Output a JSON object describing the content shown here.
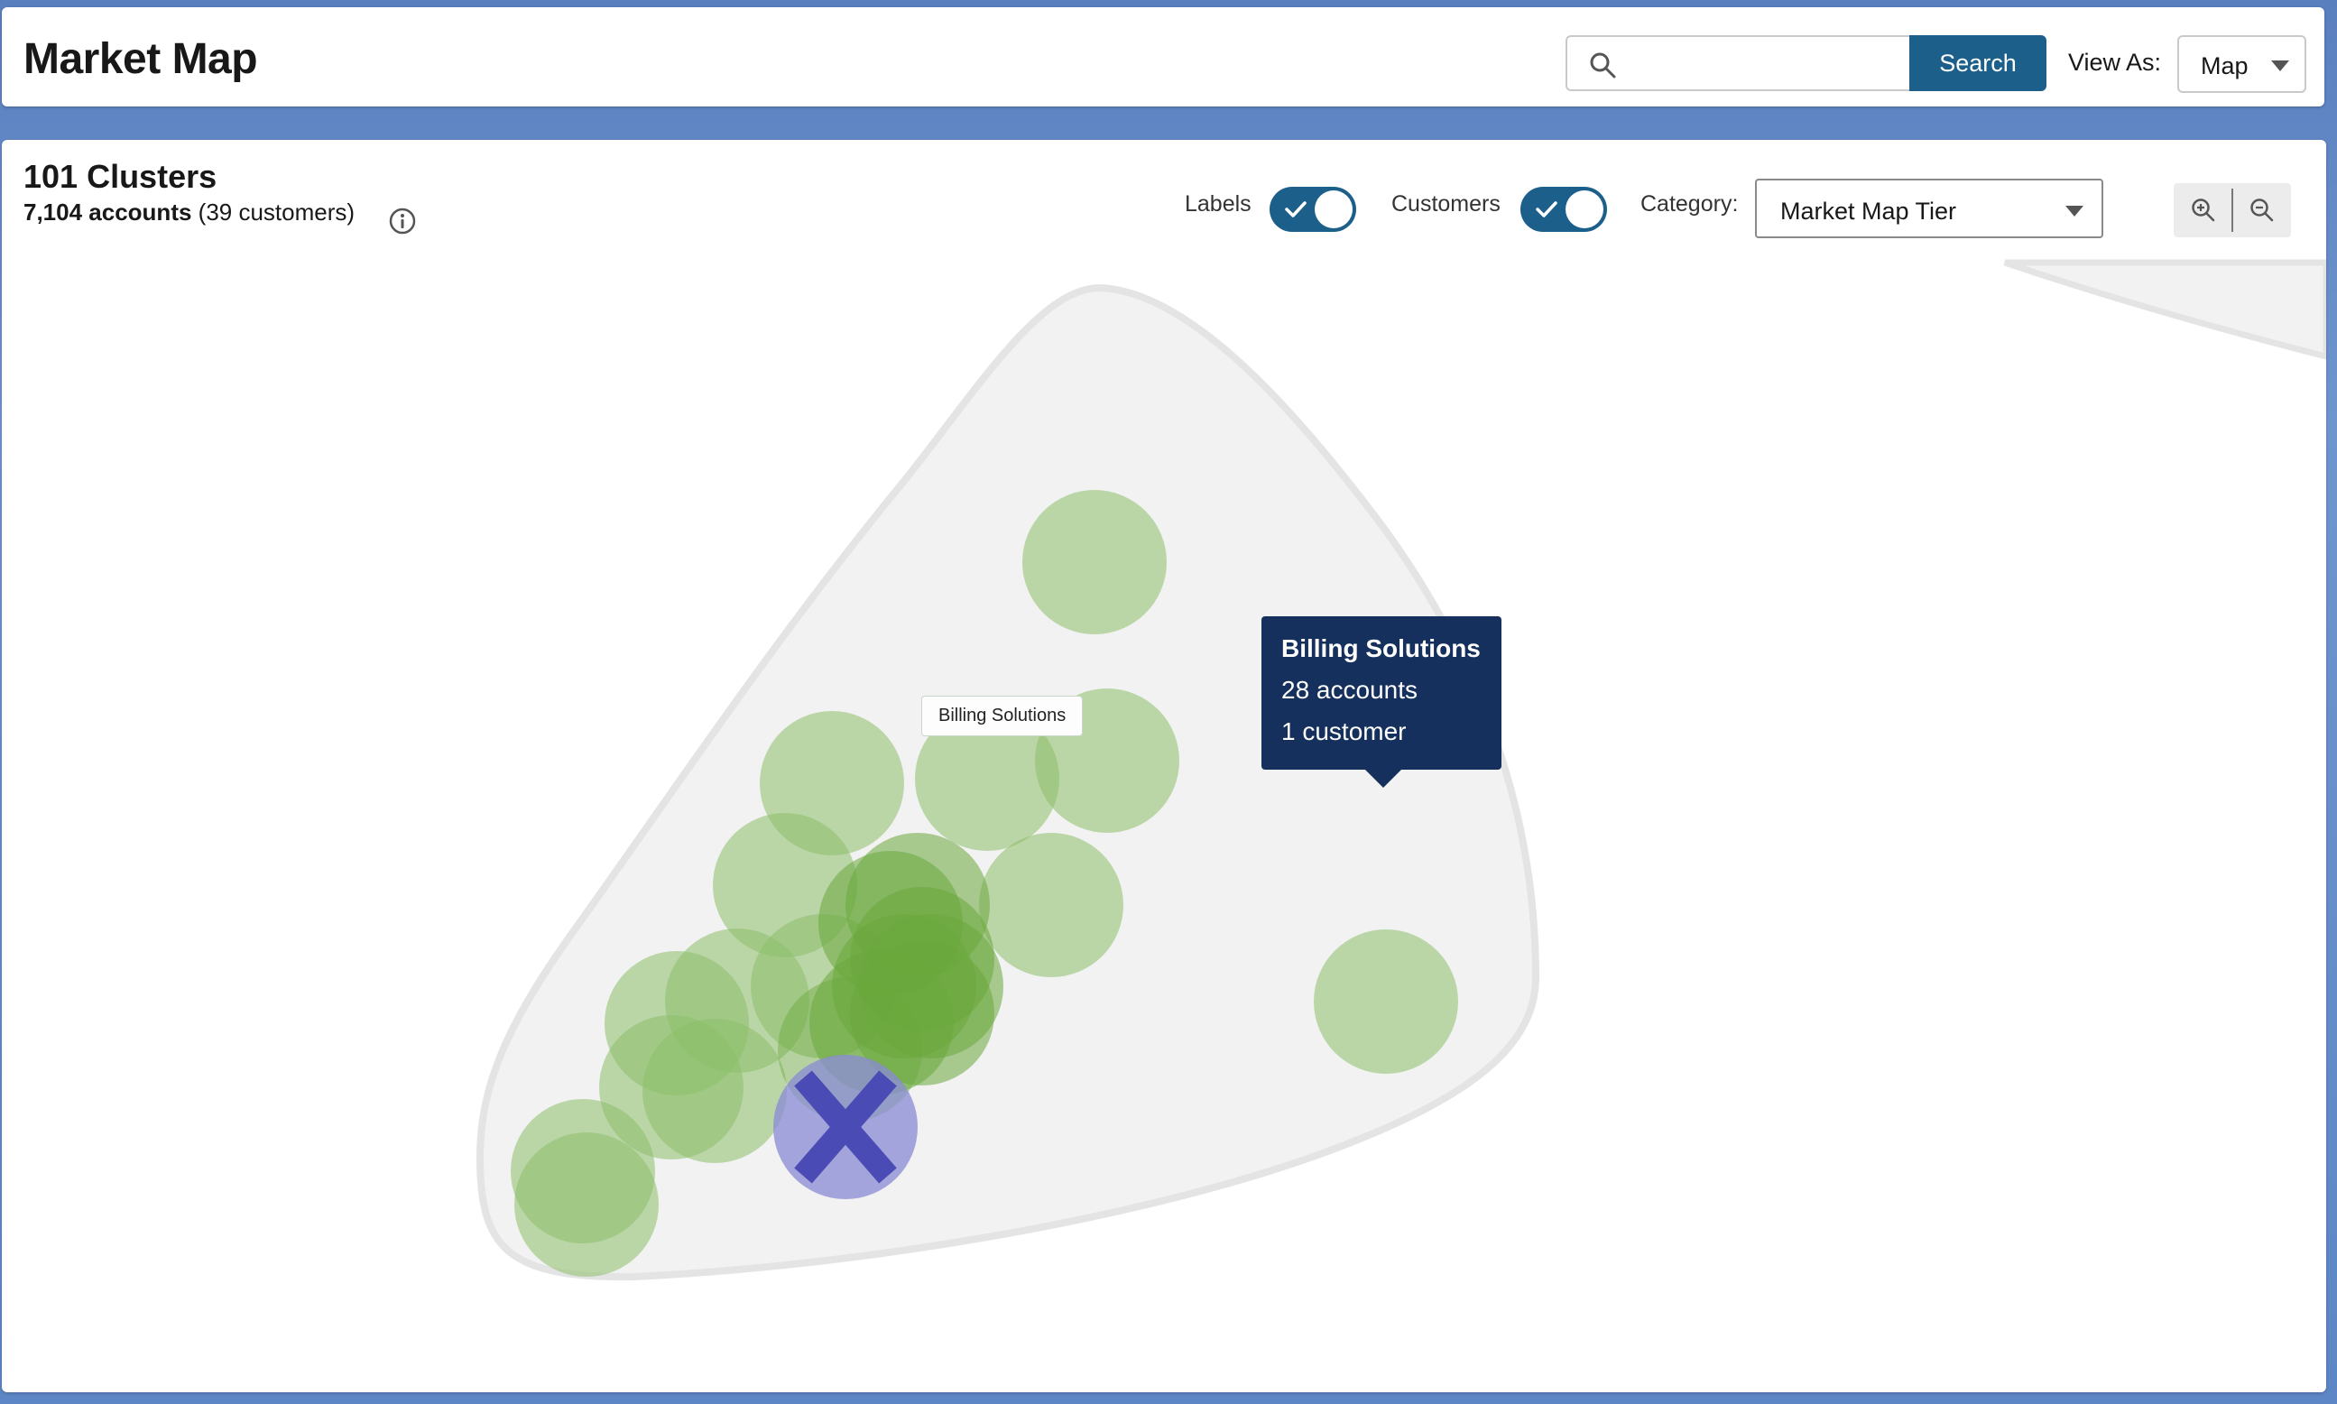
{
  "header": {
    "title": "Market Map",
    "search_placeholder": "",
    "search_value": "",
    "search_button": "Search",
    "view_as_label": "View As:",
    "view_as_value": "Map"
  },
  "summary": {
    "clusters": "101 Clusters",
    "accounts": "7,104 accounts",
    "customers": "(39 customers)"
  },
  "controls": {
    "labels_toggle": {
      "label": "Labels",
      "on": true
    },
    "customers_toggle": {
      "label": "Customers",
      "on": true
    },
    "category_label": "Category:",
    "category_value": "Market Map Tier"
  },
  "map": {
    "cluster_label": "Billing Solutions",
    "tooltip": {
      "title": "Billing Solutions",
      "accounts": "28 accounts",
      "customers": "1 customer"
    },
    "colors": {
      "bubble": "#8cbf6a",
      "bubble_dense": "#6aa83c",
      "selected": "#4b4bb5",
      "region_fill": "#f2f2f2",
      "region_stroke": "#e4e4e4"
    }
  }
}
